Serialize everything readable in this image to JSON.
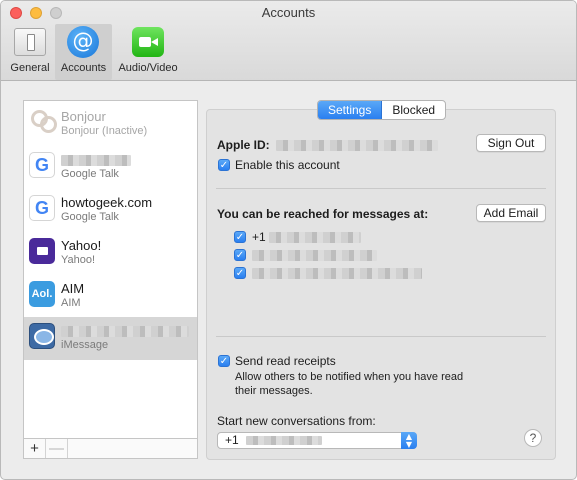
{
  "window": {
    "title": "Accounts"
  },
  "toolbar": {
    "general_label": "General",
    "accounts_label": "Accounts",
    "audio_video_label": "Audio/Video"
  },
  "accounts": [
    {
      "name": "Bonjour",
      "service": "Bonjour (Inactive)",
      "icon": "bonjour-icon"
    },
    {
      "name": "",
      "service": "Google Talk",
      "icon": "google-icon"
    },
    {
      "name": "howtogeek.com",
      "service": "Google Talk",
      "icon": "google-icon"
    },
    {
      "name": "Yahoo!",
      "service": "Yahoo!",
      "icon": "yahoo-icon"
    },
    {
      "name": "AIM",
      "service": "AIM",
      "icon": "aol-icon",
      "icon_text": "Aol."
    },
    {
      "name": "",
      "service": "iMessage",
      "icon": "imessage-icon"
    }
  ],
  "list_footer": {
    "add": "+",
    "remove": "—"
  },
  "tabs": {
    "settings": "Settings",
    "blocked": "Blocked"
  },
  "settings": {
    "apple_id_label": "Apple ID:",
    "sign_out": "Sign Out",
    "enable_account": "Enable this account",
    "reached_label": "You can be reached for messages at:",
    "add_email": "Add Email",
    "addresses": [
      "+1",
      "",
      ""
    ],
    "read_receipts_label": "Send read receipts",
    "read_receipts_desc_line1": "Allow others to be notified when you have read",
    "read_receipts_desc_line2": "their messages.",
    "start_from_label": "Start new conversations from:",
    "start_from_value": "+1",
    "help": "?"
  },
  "colors": {
    "accent": "#2a7ff0",
    "selection": "#d6d6d6"
  }
}
